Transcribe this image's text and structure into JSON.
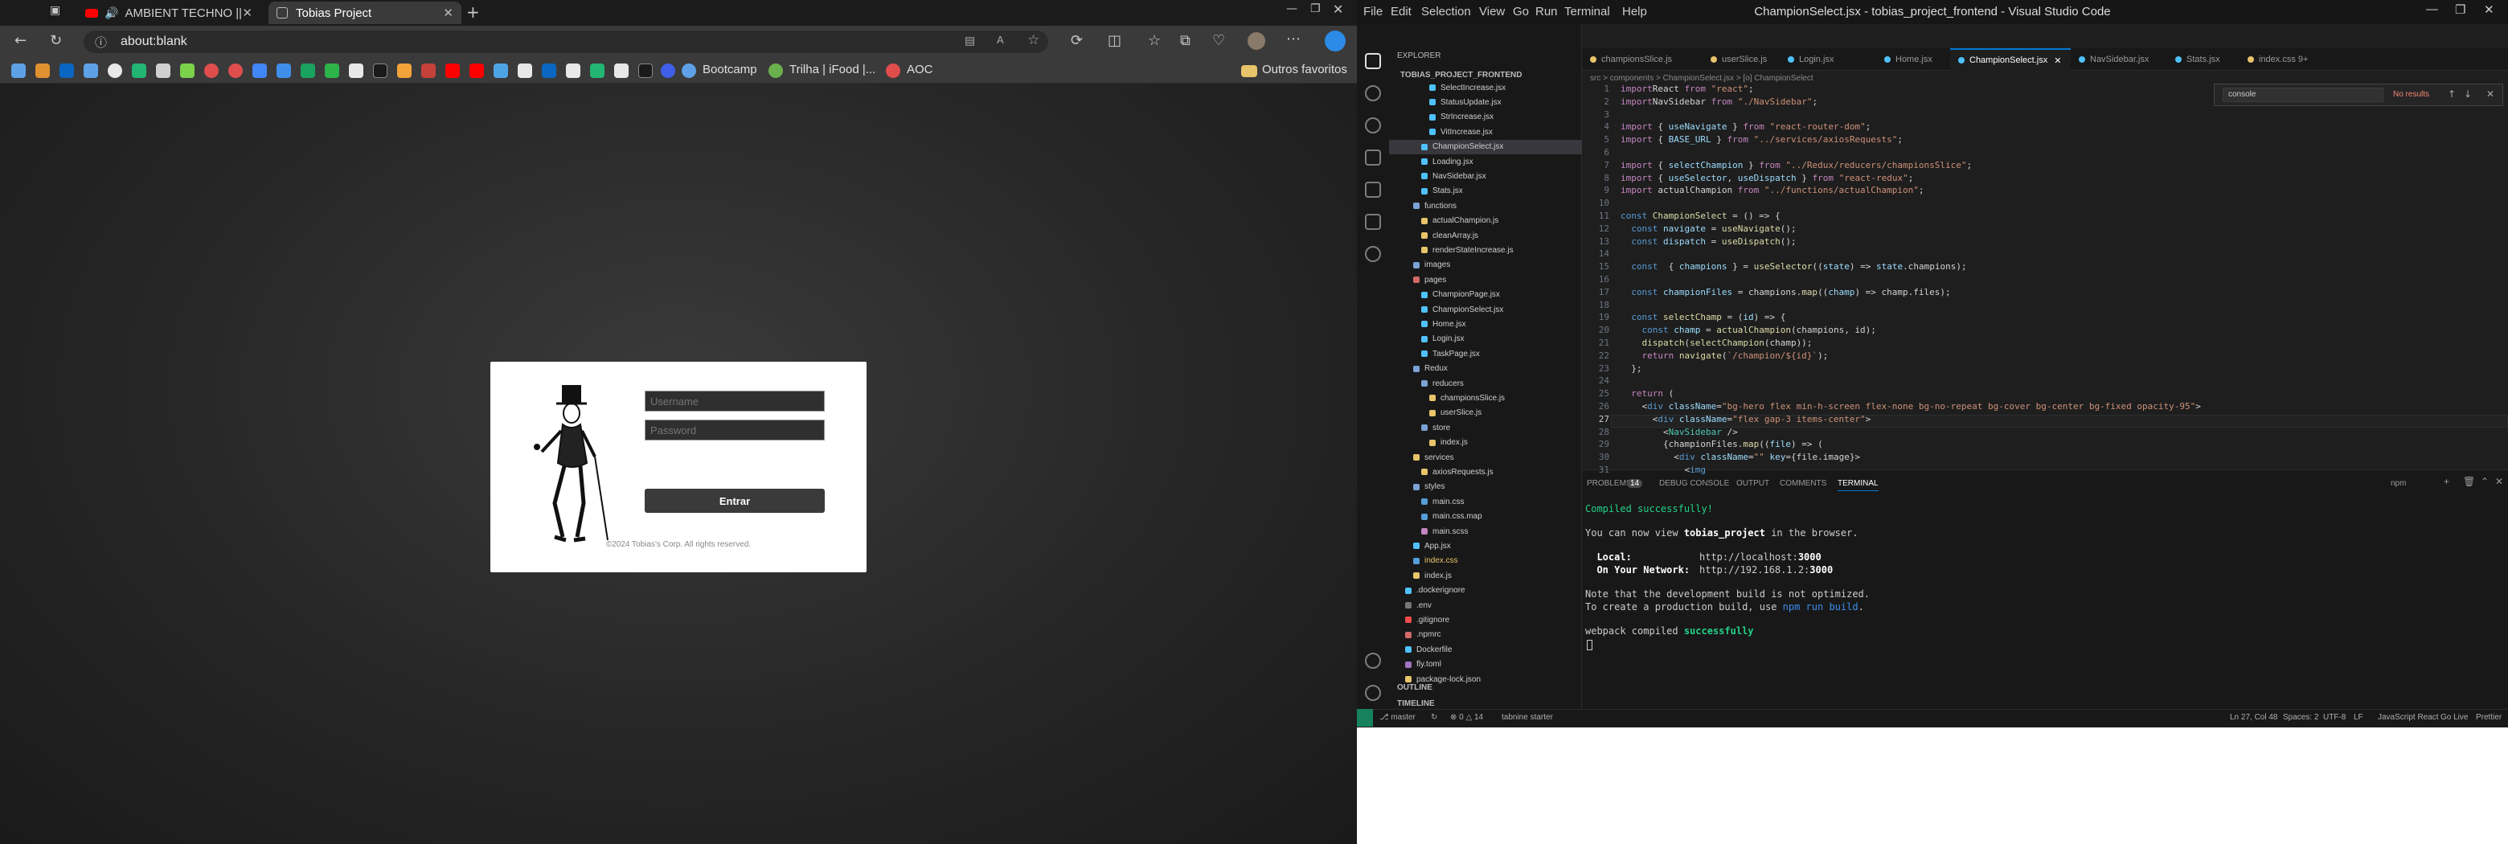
{
  "browser": {
    "tabs": [
      {
        "label": "AMBIENT TECHNO ||",
        "active": false
      },
      {
        "label": "Tobias Project",
        "active": true
      }
    ],
    "url": "about:blank",
    "bookmarks": [
      "Bootcamp",
      "Trilha | iFood |...",
      "AOC"
    ],
    "other_bookmarks": "Outros favoritos"
  },
  "login": {
    "username_placeholder": "Username",
    "password_placeholder": "Password",
    "submit_label": "Entrar",
    "copyright": "©2024 Tobias's Corp. All rights reserved."
  },
  "vscode": {
    "title": "ChampionSelect.jsx - tobias_project_frontend - Visual Studio Code",
    "menu": [
      "File",
      "Edit",
      "Selection",
      "View",
      "Go",
      "Run",
      "Terminal",
      "Help"
    ],
    "explorer_title": "EXPLORER",
    "project": "TOBIAS_PROJECT_FRONTEND",
    "files": [
      {
        "name": "SelectIncrease.jsx",
        "indent": 3,
        "color": "#4fc1ff"
      },
      {
        "name": "StatusUpdate.jsx",
        "indent": 3,
        "color": "#4fc1ff"
      },
      {
        "name": "StrIncrease.jsx",
        "indent": 3,
        "color": "#4fc1ff"
      },
      {
        "name": "VitIncrease.jsx",
        "indent": 3,
        "color": "#4fc1ff"
      },
      {
        "name": "ChampionSelect.jsx",
        "indent": 2,
        "color": "#4fc1ff",
        "selected": true
      },
      {
        "name": "Loading.jsx",
        "indent": 2,
        "color": "#4fc1ff"
      },
      {
        "name": "NavSidebar.jsx",
        "indent": 2,
        "color": "#4fc1ff"
      },
      {
        "name": "Stats.jsx",
        "indent": 2,
        "color": "#4fc1ff"
      },
      {
        "name": "functions",
        "indent": 1,
        "color": "#7aa2d6",
        "folder": true
      },
      {
        "name": "actualChampion.js",
        "indent": 2,
        "color": "#e8c46a"
      },
      {
        "name": "cleanArray.js",
        "indent": 2,
        "color": "#e8c46a"
      },
      {
        "name": "renderStateIncrease.js",
        "indent": 2,
        "color": "#e8c46a"
      },
      {
        "name": "images",
        "indent": 1,
        "color": "#7aa2d6",
        "folder": true
      },
      {
        "name": "pages",
        "indent": 1,
        "color": "#d16969",
        "folder": true
      },
      {
        "name": "ChampionPage.jsx",
        "indent": 2,
        "color": "#4fc1ff"
      },
      {
        "name": "ChampionSelect.jsx",
        "indent": 2,
        "color": "#4fc1ff"
      },
      {
        "name": "Home.jsx",
        "indent": 2,
        "color": "#4fc1ff"
      },
      {
        "name": "Login.jsx",
        "indent": 2,
        "color": "#4fc1ff"
      },
      {
        "name": "TaskPage.jsx",
        "indent": 2,
        "color": "#4fc1ff"
      },
      {
        "name": "Redux",
        "indent": 1,
        "color": "#7aa2d6",
        "folder": true
      },
      {
        "name": "reducers",
        "indent": 2,
        "color": "#7aa2d6",
        "folder": true
      },
      {
        "name": "championsSlice.js",
        "indent": 3,
        "color": "#e8c46a"
      },
      {
        "name": "userSlice.js",
        "indent": 3,
        "color": "#e8c46a"
      },
      {
        "name": "store",
        "indent": 2,
        "color": "#7aa2d6",
        "folder": true
      },
      {
        "name": "index.js",
        "indent": 3,
        "color": "#e8c46a"
      },
      {
        "name": "services",
        "indent": 1,
        "color": "#e8c46a",
        "folder": true
      },
      {
        "name": "axiosRequests.js",
        "indent": 2,
        "color": "#e8c46a"
      },
      {
        "name": "styles",
        "indent": 1,
        "color": "#7aa2d6",
        "folder": true
      },
      {
        "name": "main.css",
        "indent": 2,
        "color": "#569cd6"
      },
      {
        "name": "main.css.map",
        "indent": 2,
        "color": "#569cd6"
      },
      {
        "name": "main.scss",
        "indent": 2,
        "color": "#c586c0"
      },
      {
        "name": "App.jsx",
        "indent": 1,
        "color": "#4fc1ff"
      },
      {
        "name": "index.css",
        "indent": 1,
        "color": "#569cd6",
        "active": true
      },
      {
        "name": "index.js",
        "indent": 1,
        "color": "#e8c46a"
      },
      {
        "name": ".dockerignore",
        "indent": 0,
        "color": "#4fc1ff"
      },
      {
        "name": ".env",
        "indent": 0,
        "color": "#777777"
      },
      {
        "name": ".gitignore",
        "indent": 0,
        "color": "#f14c4c"
      },
      {
        "name": ".npmrc",
        "indent": 0,
        "color": "#d16969"
      },
      {
        "name": "Dockerfile",
        "indent": 0,
        "color": "#4fc1ff"
      },
      {
        "name": "fly.toml",
        "indent": 0,
        "color": "#a074c4"
      },
      {
        "name": "package-lock.json",
        "indent": 0,
        "color": "#e8c46a"
      }
    ],
    "outline_label": "OUTLINE",
    "timeline_label": "TIMELINE",
    "editor_tabs": [
      {
        "label": "championsSlice.js",
        "color": "#e8c46a"
      },
      {
        "label": "userSlice.js",
        "color": "#e8c46a"
      },
      {
        "label": "Login.jsx",
        "color": "#4fc1ff"
      },
      {
        "label": "Home.jsx",
        "color": "#4fc1ff"
      },
      {
        "label": "ChampionSelect.jsx",
        "color": "#4fc1ff",
        "active": true
      },
      {
        "label": "NavSidebar.jsx",
        "color": "#4fc1ff"
      },
      {
        "label": "Stats.jsx",
        "color": "#4fc1ff"
      },
      {
        "label": "index.css 9+",
        "color": "#e8c46a"
      }
    ],
    "breadcrumb": "src > components > ChampionSelect.jsx > [o] ChampionSelect",
    "find": {
      "query": "console",
      "result": "No results"
    },
    "code_lines": [
      [
        [
          "kw",
          "import"
        ],
        [
          "",
          "React "
        ],
        [
          "kw",
          "from"
        ],
        [
          "st",
          " \"react\""
        ],
        [
          "",
          ";"
        ]
      ],
      [
        [
          "kw",
          "import"
        ],
        [
          "",
          "NavSidebar "
        ],
        [
          "kw",
          "from"
        ],
        [
          "st",
          " \"./NavSidebar\""
        ],
        [
          "",
          ";"
        ]
      ],
      [],
      [
        [
          "kw",
          "import"
        ],
        [
          "",
          " { "
        ],
        [
          "vr",
          "useNavigate"
        ],
        [
          "",
          " } "
        ],
        [
          "kw",
          "from"
        ],
        [
          "st",
          " \"react-router-dom\""
        ],
        [
          "",
          ";"
        ]
      ],
      [
        [
          "kw",
          "import"
        ],
        [
          "",
          " { "
        ],
        [
          "vr",
          "BASE_URL"
        ],
        [
          "",
          " } "
        ],
        [
          "kw",
          "from"
        ],
        [
          "st",
          " \"../services/axiosRequests\""
        ],
        [
          "",
          ";"
        ]
      ],
      [],
      [
        [
          "kw",
          "import"
        ],
        [
          "",
          " { "
        ],
        [
          "vr",
          "selectChampion"
        ],
        [
          "",
          " } "
        ],
        [
          "kw",
          "from"
        ],
        [
          "st",
          " \"../Redux/reducers/championsSlice\""
        ],
        [
          "",
          ";"
        ]
      ],
      [
        [
          "kw",
          "import"
        ],
        [
          "",
          " { "
        ],
        [
          "vr",
          "useSelector"
        ],
        [
          "",
          ", "
        ],
        [
          "vr",
          "useDispatch"
        ],
        [
          "",
          " } "
        ],
        [
          "kw",
          "from"
        ],
        [
          "st",
          " \"react-redux\""
        ],
        [
          "",
          ";"
        ]
      ],
      [
        [
          "kw",
          "import"
        ],
        [
          "",
          " actualChampion "
        ],
        [
          "kw",
          "from"
        ],
        [
          "st",
          " \"../functions/actualChampion\""
        ],
        [
          "",
          ";"
        ]
      ],
      [],
      [
        [
          "bl",
          "const "
        ],
        [
          "fn",
          "ChampionSelect"
        ],
        [
          "",
          " = () => {"
        ]
      ],
      [
        [
          "",
          "  "
        ],
        [
          "bl",
          "const "
        ],
        [
          "vr",
          "navigate"
        ],
        [
          "",
          " = "
        ],
        [
          "fn",
          "useNavigate"
        ],
        [
          "",
          "();"
        ]
      ],
      [
        [
          "",
          "  "
        ],
        [
          "bl",
          "const "
        ],
        [
          "vr",
          "dispatch"
        ],
        [
          "",
          " = "
        ],
        [
          "fn",
          "useDispatch"
        ],
        [
          "",
          "();"
        ]
      ],
      [],
      [
        [
          "",
          "  "
        ],
        [
          "bl",
          "const "
        ],
        [
          "",
          " { "
        ],
        [
          "vr",
          "champions"
        ],
        [
          "",
          " } = "
        ],
        [
          "fn",
          "useSelector"
        ],
        [
          "",
          "(("
        ],
        [
          "vr",
          "state"
        ],
        [
          "",
          ") => "
        ],
        [
          "vr",
          "state"
        ],
        [
          "",
          ".champions);"
        ]
      ],
      [],
      [
        [
          "",
          "  "
        ],
        [
          "bl",
          "const "
        ],
        [
          "vr",
          "championFiles"
        ],
        [
          "",
          " = champions."
        ],
        [
          "fn",
          "map"
        ],
        [
          "",
          "(("
        ],
        [
          "vr",
          "champ"
        ],
        [
          "",
          ") => champ.files);"
        ]
      ],
      [],
      [
        [
          "",
          "  "
        ],
        [
          "bl",
          "const "
        ],
        [
          "fn",
          "selectChamp"
        ],
        [
          "",
          " = ("
        ],
        [
          "vr",
          "id"
        ],
        [
          "",
          ") => {"
        ]
      ],
      [
        [
          "",
          "    "
        ],
        [
          "bl",
          "const "
        ],
        [
          "vr",
          "champ"
        ],
        [
          "",
          " = "
        ],
        [
          "fn",
          "actualChampion"
        ],
        [
          "",
          "(champions, id);"
        ]
      ],
      [
        [
          "",
          "    "
        ],
        [
          "fn",
          "dispatch"
        ],
        [
          "",
          "("
        ],
        [
          "fn",
          "selectChampion"
        ],
        [
          "",
          "(champ));"
        ]
      ],
      [
        [
          "",
          "    "
        ],
        [
          "kw",
          "return "
        ],
        [
          "fn",
          "navigate"
        ],
        [
          "",
          "("
        ],
        [
          "st",
          "`/champion/${id}`"
        ],
        [
          "",
          ");"
        ]
      ],
      [
        [
          "",
          "  };"
        ]
      ],
      [],
      [
        [
          "",
          "  "
        ],
        [
          "kw",
          "return"
        ],
        [
          "",
          " ("
        ]
      ],
      [
        [
          "",
          "    <"
        ],
        [
          "bl",
          "div "
        ],
        [
          "at",
          "className"
        ],
        [
          "",
          "="
        ],
        [
          "st",
          "\"bg-hero flex min-h-screen flex-none bg-no-repeat bg-cover bg-center bg-fixed opacity-95\""
        ],
        [
          "",
          ">"
        ]
      ],
      [
        [
          "",
          "      <"
        ],
        [
          "bl",
          "div "
        ],
        [
          "at",
          "className"
        ],
        [
          "",
          "="
        ],
        [
          "st",
          "\"flex gap-3 items-center\""
        ],
        [
          "",
          ">"
        ]
      ],
      [
        [
          "",
          "        <"
        ],
        [
          "tg",
          "NavSidebar"
        ],
        [
          "",
          " />"
        ]
      ],
      [
        [
          "",
          "        {championFiles."
        ],
        [
          "fn",
          "map"
        ],
        [
          "",
          "(("
        ],
        [
          "vr",
          "file"
        ],
        [
          "",
          ") => ("
        ]
      ],
      [
        [
          "",
          "          <"
        ],
        [
          "bl",
          "div "
        ],
        [
          "at",
          "className"
        ],
        [
          "",
          "="
        ],
        [
          "st",
          "\"\" "
        ],
        [
          "at",
          "key"
        ],
        [
          "",
          "={file.image}>"
        ]
      ],
      [
        [
          "",
          "            <"
        ],
        [
          "bl",
          "img"
        ]
      ]
    ],
    "panel_tabs": [
      "PROBLEMS",
      "DEBUG CONSOLE",
      "OUTPUT",
      "COMMENTS",
      "TERMINAL"
    ],
    "problems_count": "14",
    "terminal_kind": "npm",
    "terminal": {
      "compiled": "Compiled successfully!",
      "view_prefix": "You can now view ",
      "project": "tobias_project",
      "view_suffix": " in the browser.",
      "local_label": "  Local:",
      "local_url_prefix": "http://localhost:",
      "local_port": "3000",
      "network_label": "  On Your Network:",
      "network_url_prefix": "http://192.168.1.2:",
      "network_port": "3000",
      "note1": "Note that the development build is not optimized.",
      "note2_prefix": "To create a production build, use ",
      "note2_cmd": "npm run build",
      "note2_suffix": ".",
      "webpack_prefix": "webpack compiled ",
      "webpack_status": "successfully"
    },
    "status": {
      "branch": "master",
      "errors": "0 △ 14",
      "tabnine": "tabnine starter",
      "position": "Ln 27, Col 48",
      "spaces": "Spaces: 2",
      "encoding": "UTF-8",
      "eol": "LF",
      "lang": "JavaScript React",
      "golive": "Go Live",
      "prettier": "Prettier"
    }
  }
}
